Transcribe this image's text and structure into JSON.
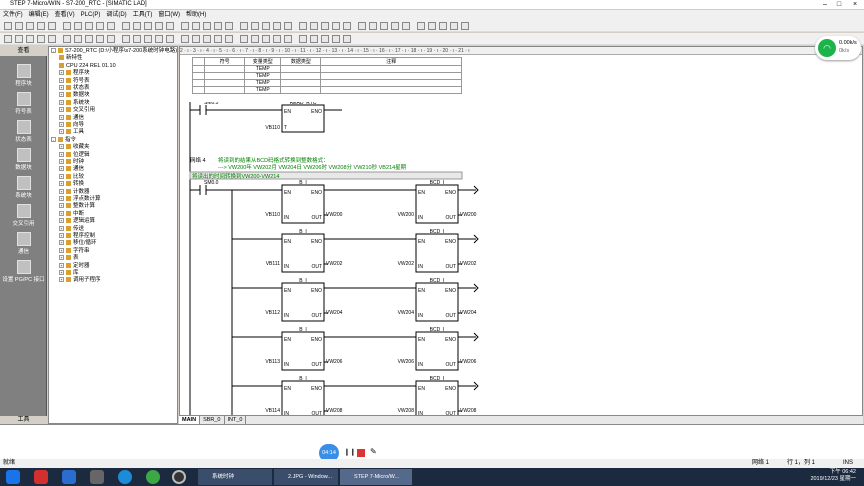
{
  "window": {
    "title": "STEP 7-Micro/WIN - S7-200_RTC - [SIMATIC LAD]",
    "minimize": "–",
    "maximize": "□",
    "close": "×"
  },
  "menu": [
    "文件(F)",
    "编辑(E)",
    "查看(V)",
    "PLC(P)",
    "调试(D)",
    "工具(T)",
    "窗口(W)",
    "帮助(H)"
  ],
  "nav": {
    "header": "查看",
    "footer": "工具",
    "items": [
      "程序块",
      "符号表",
      "状态表",
      "数据块",
      "系统块",
      "交叉引用",
      "通信",
      "设置 PG/PC 接口"
    ]
  },
  "tree": [
    {
      "label": "S7-200_RTC (D:\\小程序\\s7-200系统时钟电路)",
      "level": 0,
      "exp": "-"
    },
    {
      "label": "新特性",
      "level": 1,
      "exp": ""
    },
    {
      "label": "CPU 224 REL 01.10",
      "level": 1,
      "exp": ""
    },
    {
      "label": "程序块",
      "level": 1,
      "exp": "+"
    },
    {
      "label": "符号表",
      "level": 1,
      "exp": "+"
    },
    {
      "label": "状态表",
      "level": 1,
      "exp": "+"
    },
    {
      "label": "数据块",
      "level": 1,
      "exp": "+"
    },
    {
      "label": "系统块",
      "level": 1,
      "exp": "+"
    },
    {
      "label": "交叉引用",
      "level": 1,
      "exp": "+"
    },
    {
      "label": "通信",
      "level": 1,
      "exp": "+"
    },
    {
      "label": "向导",
      "level": 1,
      "exp": "+"
    },
    {
      "label": "工具",
      "level": 1,
      "exp": "+"
    },
    {
      "label": "指令",
      "level": 0,
      "exp": "-"
    },
    {
      "label": "收藏夹",
      "level": 1,
      "exp": "+"
    },
    {
      "label": "位逻辑",
      "level": 1,
      "exp": "+"
    },
    {
      "label": "时钟",
      "level": 1,
      "exp": "+"
    },
    {
      "label": "通信",
      "level": 1,
      "exp": "+"
    },
    {
      "label": "比较",
      "level": 1,
      "exp": "+"
    },
    {
      "label": "转换",
      "level": 1,
      "exp": "+"
    },
    {
      "label": "计数器",
      "level": 1,
      "exp": "+"
    },
    {
      "label": "浮点数计算",
      "level": 1,
      "exp": "+"
    },
    {
      "label": "整数计算",
      "level": 1,
      "exp": "+"
    },
    {
      "label": "中断",
      "level": 1,
      "exp": "+"
    },
    {
      "label": "逻辑运算",
      "level": 1,
      "exp": "+"
    },
    {
      "label": "传送",
      "level": 1,
      "exp": "+"
    },
    {
      "label": "程序控制",
      "level": 1,
      "exp": "+"
    },
    {
      "label": "移位/循环",
      "level": 1,
      "exp": "+"
    },
    {
      "label": "字符串",
      "level": 1,
      "exp": "+"
    },
    {
      "label": "表",
      "level": 1,
      "exp": "+"
    },
    {
      "label": "定时器",
      "level": 1,
      "exp": "+"
    },
    {
      "label": "库",
      "level": 1,
      "exp": "+"
    },
    {
      "label": "调用子程序",
      "level": 1,
      "exp": "+"
    }
  ],
  "ruler": "2 · ı · 3 · ı · 4 · ı · 5 · ı · 6 · ı · 7 · ı · 8 · ı · 9 · ı · 10 · ı · 11 · ı · 12 · ı · 13 · ı · 14 · ı · 15 · ı · 16 · ı · 17 · ı · 18 · ı · 19 · ı · 20 · ı · 21 · ı",
  "vartable": {
    "headers": [
      "",
      "符号",
      "变量类型",
      "数据类型",
      "注释"
    ],
    "rows": [
      [
        "",
        "",
        "TEMP",
        "",
        ""
      ],
      [
        "",
        "",
        "TEMP",
        "",
        ""
      ],
      [
        "",
        "",
        "TEMP",
        "",
        ""
      ],
      [
        "",
        "",
        "TEMP",
        "",
        ""
      ]
    ]
  },
  "network3": {
    "contact": "SM0.5",
    "box": "READ_RTC",
    "en": "EN",
    "eno": "ENO",
    "pin": "T",
    "operand": "VB110"
  },
  "network4": {
    "label": "网络 4",
    "comment1": "将读到的结果从BCD码格式转换到整数格式：",
    "comment2": "---> VW200年  VW202月  VW204日  VW206时  VW208分  VW210秒  VB214星期",
    "title": "将读出的时间转换到VW200-VW214",
    "contact": "SM0.0",
    "rows": [
      {
        "b_in": "VB110",
        "b_out": "VW200",
        "c_in": "VW200",
        "c_out": "VW200"
      },
      {
        "b_in": "VB111",
        "b_out": "VW202",
        "c_in": "VW202",
        "c_out": "VW202"
      },
      {
        "b_in": "VB112",
        "b_out": "VW204",
        "c_in": "VW204",
        "c_out": "VW204"
      },
      {
        "b_in": "VB113",
        "b_out": "VW206",
        "c_in": "VW206",
        "c_out": "VW206"
      },
      {
        "b_in": "VB114",
        "b_out": "VW208",
        "c_in": "VW208",
        "c_out": "VW208"
      }
    ],
    "box1": "B_I",
    "box2": "BCD_I",
    "in": "IN",
    "out": "OUT",
    "en": "EN",
    "eno": "ENO"
  },
  "tabs": [
    "MAIN",
    "SBR_0",
    "INT_0"
  ],
  "status": {
    "left": "就绪",
    "network": "网络 1",
    "rowcol": "行 1，列 1",
    "mode": "INS"
  },
  "wifi": {
    "speed": "0.00k/s",
    "sub": "0k/s"
  },
  "player": {
    "time": "04:14"
  },
  "taskbar": {
    "tasks": [
      "系统时钟",
      "2.JPG - Window...",
      "STEP 7-Micro/W..."
    ],
    "time": "下午 06:42",
    "date": "2019/12/23 星期一"
  },
  "colors": {
    "comment": "#008000",
    "title_bg": "#e8e8e8",
    "taskbar": "#1c2a3f"
  }
}
